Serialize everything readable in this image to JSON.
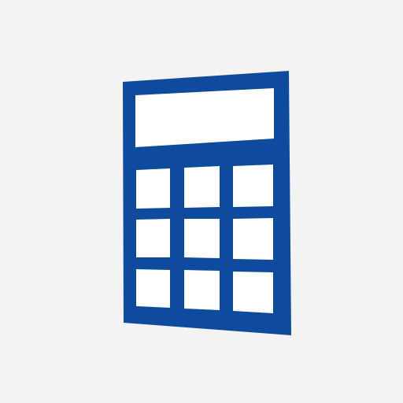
{
  "icon": {
    "name": "calculator-icon",
    "colors": {
      "background": "#f3f3f3",
      "stroke": "#0f4b9c",
      "fill": "#ffffff"
    },
    "keypad": {
      "rows": 3,
      "columns": 3
    }
  }
}
